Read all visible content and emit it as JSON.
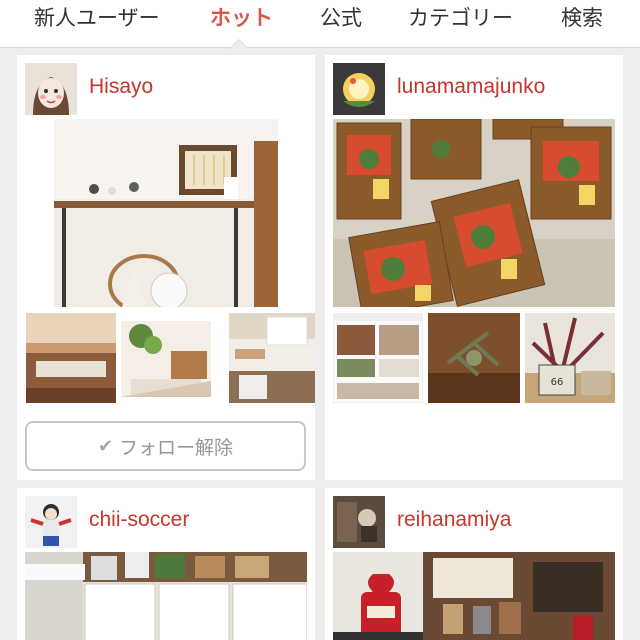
{
  "tabs": [
    {
      "label": "新人ユーザー",
      "active": false
    },
    {
      "label": "ホット",
      "active": true
    },
    {
      "label": "公式",
      "active": false
    },
    {
      "label": "カテゴリー",
      "active": false
    },
    {
      "label": "検索",
      "active": false
    }
  ],
  "colors": {
    "accent": "#d9564a",
    "username": "#c6362b",
    "background": "#efedeb"
  },
  "cards": [
    {
      "username": "Hisayo",
      "button": {
        "icon": "check-icon",
        "label": "フォロー解除"
      }
    },
    {
      "username": "lunamamajunko"
    },
    {
      "username": "chii-soccer"
    },
    {
      "username": "reihanamiya"
    }
  ]
}
